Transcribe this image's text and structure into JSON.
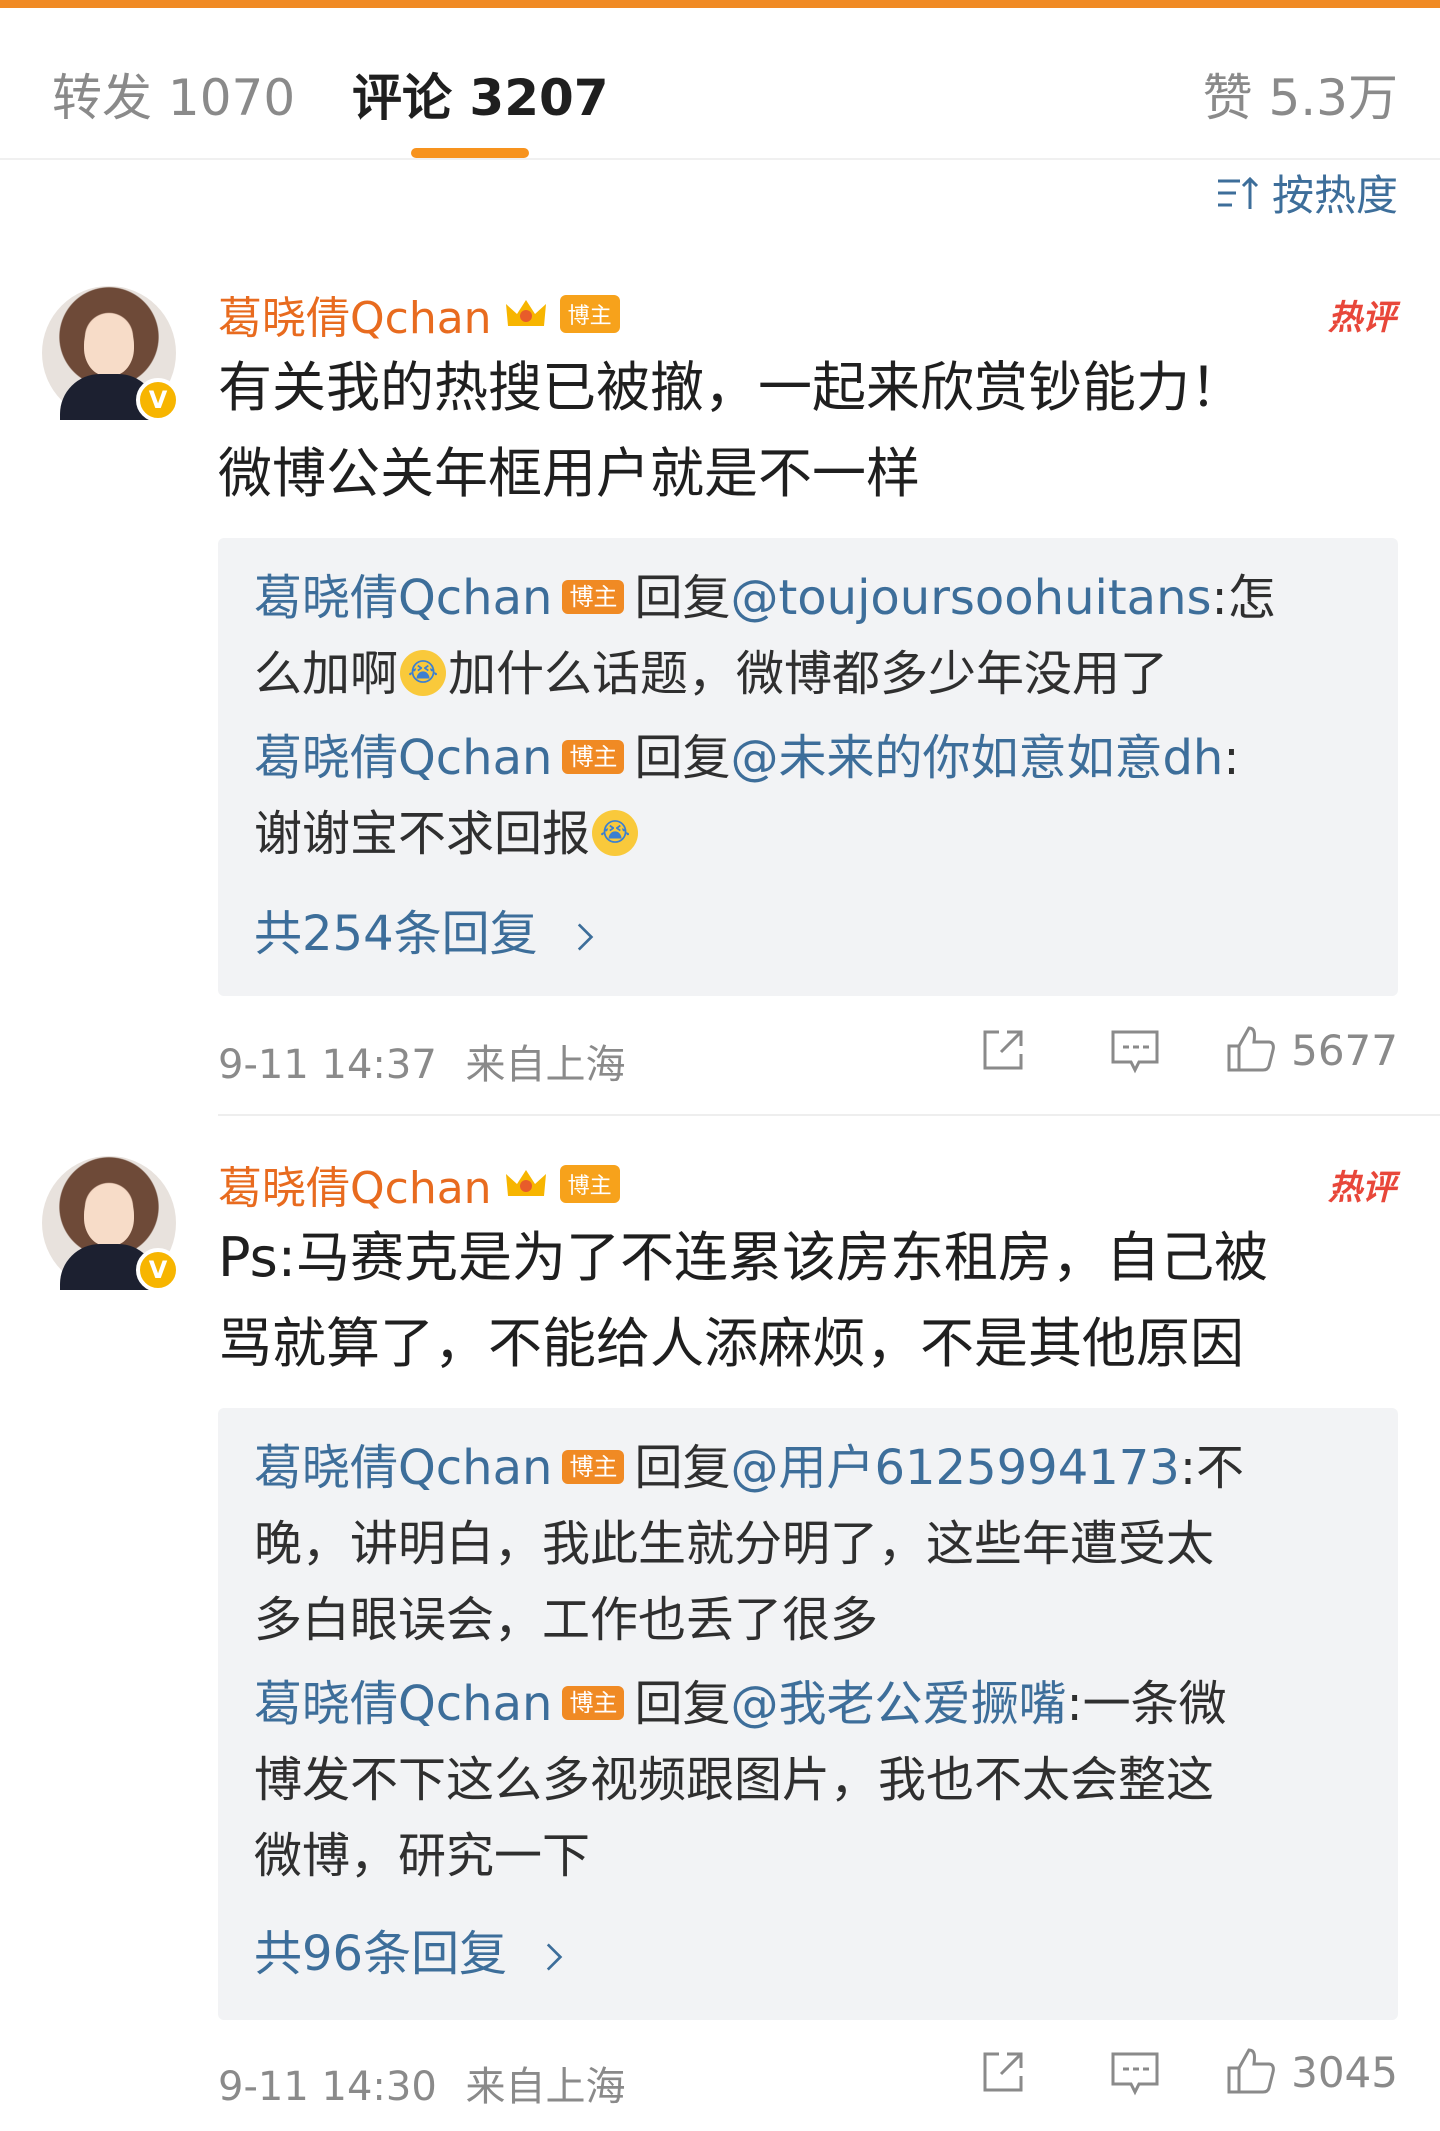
{
  "tabs": {
    "repost": "转发 1070",
    "comments": "评论 3207",
    "likes": "赞 5.3万"
  },
  "sort": {
    "label": "按热度"
  },
  "comments": [
    {
      "username": "葛晓倩Qchan",
      "badge": "博主",
      "hot_label": "热评",
      "line1": "有关我的热搜已被撤，一起来欣赏钞能力！",
      "line2": "微博公关年框用户就是不一样",
      "replies": [
        {
          "name": "葛晓倩Qchan",
          "badge": "博主",
          "reply_word": "回复",
          "at": "@toujoursoohuitans",
          "text_a": ":怎",
          "text_b": "么加啊",
          "emoji": "😭",
          "text_c": "加什么话题，微博都多少年没用了"
        },
        {
          "name": "葛晓倩Qchan",
          "badge": "博主",
          "reply_word": "回复",
          "at": "@未来的你如意如意dh",
          "text_a": ":",
          "text_b": "谢谢宝不求回报",
          "emoji": "😭"
        }
      ],
      "more": "共254条回复",
      "time": "9-11 14:37",
      "location": "来自上海",
      "like_count": "5677"
    },
    {
      "username": "葛晓倩Qchan",
      "badge": "博主",
      "hot_label": "热评",
      "line1": "Ps:马赛克是为了不连累该房东租房，自己被",
      "line2": "骂就算了，不能给人添麻烦，不是其他原因",
      "replies": [
        {
          "name": "葛晓倩Qchan",
          "badge": "博主",
          "reply_word": "回复",
          "at": "@用户6125994173",
          "text_a": ":不",
          "text_b": "晚，讲明白，我此生就分明了，这些年遭受太",
          "text_c": "多白眼误会，工作也丢了很多"
        },
        {
          "name": "葛晓倩Qchan",
          "badge": "博主",
          "reply_word": "回复",
          "at": "@我老公爱撅嘴",
          "text_a": ":一条微",
          "text_b": "博发不下这么多视频跟图片，我也不太会整这",
          "text_c": "微博，研究一下"
        }
      ],
      "more": "共96条回复",
      "time": "9-11 14:30",
      "location": "来自上海",
      "like_count": "3045"
    }
  ],
  "colors": {
    "accent_orange": "#f7931e",
    "link_blue": "#3d6e9a",
    "username_orange": "#e86b1f",
    "hot_red": "#e8473a"
  }
}
